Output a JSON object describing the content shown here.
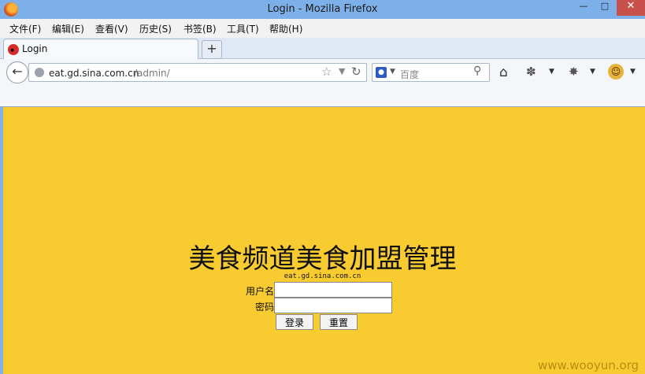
{
  "window": {
    "title": "Login - Mozilla Firefox",
    "controls": {
      "minimize": "—",
      "maximize": "□",
      "close": "✕"
    }
  },
  "menu": [
    "文件(F)",
    "编辑(E)",
    "查看(V)",
    "历史(S)",
    "书签(B)",
    "工具(T)",
    "帮助(H)"
  ],
  "tab": {
    "label": "Login",
    "new_tab": "+"
  },
  "navbar": {
    "url_host": "eat.gd.sina.com.cn",
    "url_path": "/admin/",
    "search_placeholder": "百度",
    "search_engine_icon": "baidu-paw-icon",
    "icons": [
      "back-arrow-icon",
      "globe-icon",
      "star-icon",
      "dropdown-icon",
      "reload-icon",
      "magnifier-icon",
      "home-icon",
      "extension-icon",
      "extension-icon",
      "smiley-icon"
    ]
  },
  "page": {
    "heading": "美食频道美食加盟管理",
    "domain": "eat.gd.sina.com.cn",
    "username_label": "用户名",
    "password_label": "密码",
    "login_button": "登录",
    "reset_button": "重置",
    "background_color": "#f8cb30"
  },
  "watermark": "www.wooyun.org"
}
